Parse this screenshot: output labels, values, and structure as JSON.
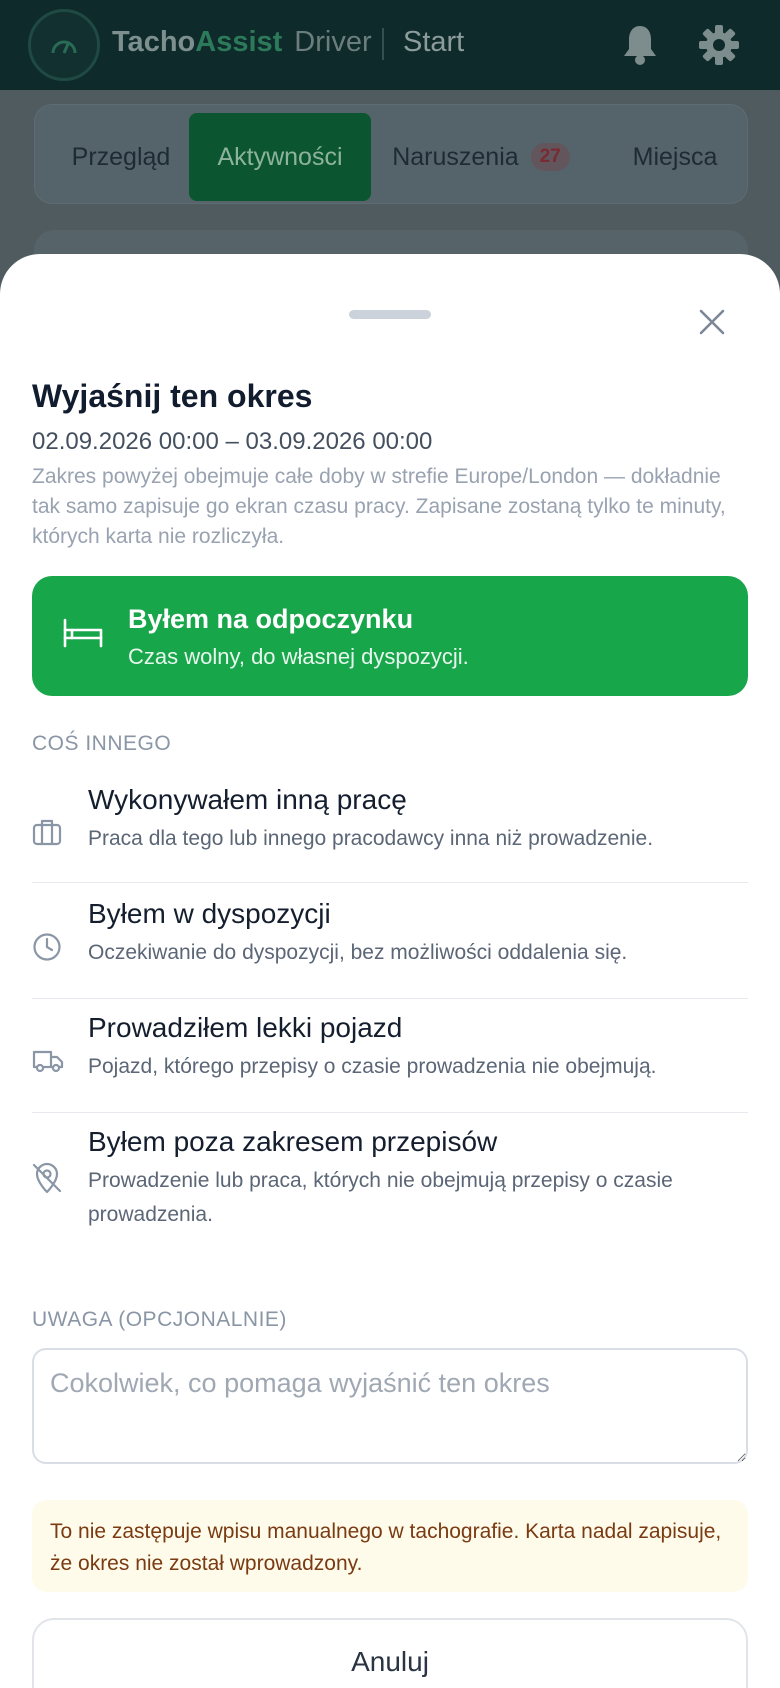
{
  "app": {
    "brand_part1": "Tacho",
    "brand_part2": "Assist",
    "brand_part3": "Driver",
    "page": "Start",
    "icons": [
      "speedometer-logo-icon",
      "bell-icon",
      "gear-icon"
    ]
  },
  "tabs": [
    {
      "label": "Przegląd",
      "active": false
    },
    {
      "label": "Aktywności",
      "active": true
    },
    {
      "label": "Naruszenia",
      "badge": "27",
      "active": false
    },
    {
      "label": "Miejsca",
      "active": false
    }
  ],
  "sheet": {
    "title": "Wyjaśnij ten okres",
    "date_range": "02.09.2026 00:00 – 03.09.2026 00:00",
    "description": "Zakres powyżej obejmuje całe doby w strefie Europe/London — dokładnie tak samo zapisuje go ekran czasu pracy. Zapisane zostaną tylko te minuty, których karta nie rozliczyła.",
    "primary": {
      "title": "Byłem na odpoczynku",
      "subtitle": "Czas wolny, do własnej dyspozycji.",
      "icon": "bed-icon"
    },
    "section_label": "COŚ INNEGO",
    "options": [
      {
        "title": "Wykonywałem inną pracę",
        "subtitle": "Praca dla tego lub innego pracodawcy inna niż prowadzenie.",
        "icon": "briefcase-icon"
      },
      {
        "title": "Byłem w dyspozycji",
        "subtitle": "Oczekiwanie do dyspozycji, bez możliwości oddalenia się.",
        "icon": "clock-icon"
      },
      {
        "title": "Prowadziłem lekki pojazd",
        "subtitle": "Pojazd, którego przepisy o czasie prowadzenia nie obejmują.",
        "icon": "truck-icon"
      },
      {
        "title": "Byłem poza zakresem przepisów",
        "subtitle": "Prowadzenie lub praca, których nie obejmują przepisy o czasie prowadzenia.",
        "icon": "location-off-icon"
      }
    ],
    "note_label": "UWAGA (OPCJONALNIE)",
    "note_placeholder": "Cokolwiek, co pomaga wyjaśnić ten okres",
    "note_value": "",
    "warning": "To nie zastępuje wpisu manualnego w tachografie. Karta nadal zapisuje, że okres nie został wprowadzony.",
    "cancel_label": "Anuluj"
  },
  "colors": {
    "primary_green": "#18a64b",
    "topbar": "#0e2a2a",
    "warning_bg": "#fffbea",
    "warning_text": "#7a3a12",
    "badge": "#7a2a33"
  }
}
